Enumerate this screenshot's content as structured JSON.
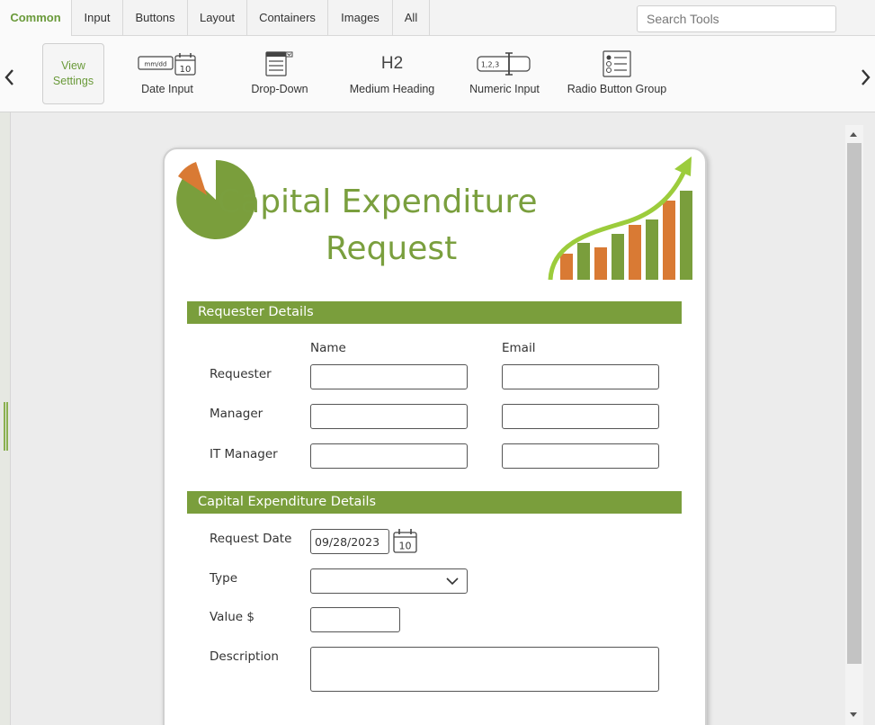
{
  "tabs": [
    {
      "label": "Common",
      "active": true
    },
    {
      "label": "Input",
      "active": false
    },
    {
      "label": "Buttons",
      "active": false
    },
    {
      "label": "Layout",
      "active": false
    },
    {
      "label": "Containers",
      "active": false
    },
    {
      "label": "Images",
      "active": false
    },
    {
      "label": "All",
      "active": false
    }
  ],
  "search": {
    "placeholder": "Search Tools"
  },
  "toolbar": {
    "view_settings_line1": "View",
    "view_settings_line2": "Settings",
    "tools": [
      {
        "label": "Date Input",
        "icon": "date-input-icon",
        "icon_text": "mm/dd",
        "icon_day": "10"
      },
      {
        "label": "Drop-Down",
        "icon": "dropdown-icon"
      },
      {
        "label": "Medium Heading",
        "icon": "heading-icon",
        "icon_text": "H2"
      },
      {
        "label": "Numeric Input",
        "icon": "numeric-input-icon",
        "icon_text": "1,2,3"
      },
      {
        "label": "Radio Button Group",
        "icon": "radio-group-icon"
      }
    ]
  },
  "form": {
    "title_line1": "Capital Expenditure",
    "title_line2": "Request",
    "sections": {
      "requester": {
        "title": "Requester Details",
        "col_name": "Name",
        "col_email": "Email",
        "rows": [
          {
            "label": "Requester",
            "name": "",
            "email": ""
          },
          {
            "label": "Manager",
            "name": "",
            "email": ""
          },
          {
            "label": "IT Manager",
            "name": "",
            "email": ""
          }
        ]
      },
      "capex": {
        "title": "Capital Expenditure Details",
        "request_date_label": "Request Date",
        "request_date_value": "09/28/2023",
        "calendar_day": "10",
        "type_label": "Type",
        "type_value": "",
        "value_label": "Value $",
        "value_value": "",
        "description_label": "Description",
        "description_value": ""
      }
    }
  },
  "colors": {
    "accent_green": "#7a9e3c",
    "accent_orange": "#d97a34",
    "bright_green": "#9ccc3c",
    "active_tab_text": "#6a9a3a"
  }
}
